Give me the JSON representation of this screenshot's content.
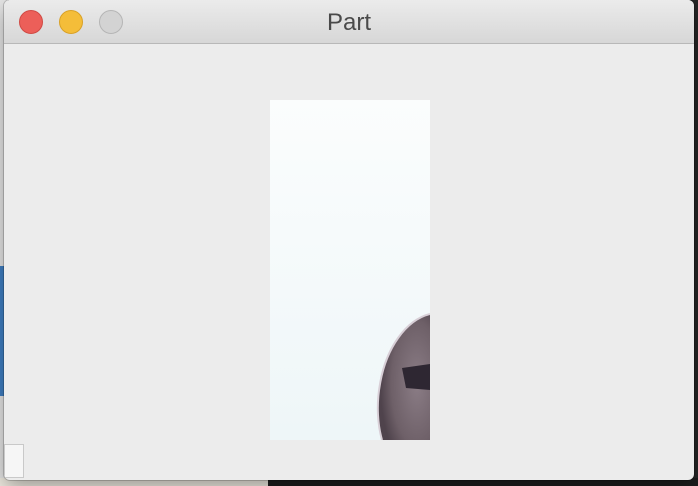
{
  "window": {
    "title": "Part",
    "buttons": {
      "close": "close-button",
      "minimize": "minimize-button",
      "zoom": "zoom-button"
    }
  },
  "colors": {
    "close": "#ec5f59",
    "minimize": "#f4bd39",
    "zoom": "#d3d3d3",
    "window_bg": "#ececec"
  }
}
